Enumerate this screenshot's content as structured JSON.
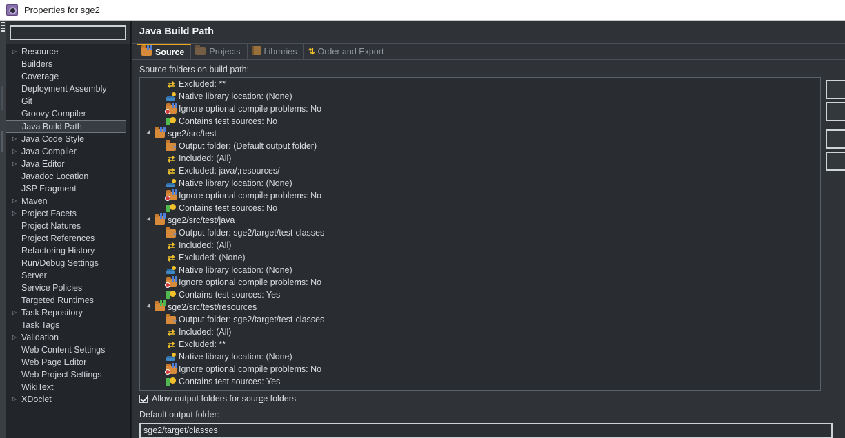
{
  "window": {
    "title": "Properties for sge2",
    "icon": "properties-gear-icon"
  },
  "sidebar": {
    "filter": {
      "value": "",
      "placeholder": ""
    },
    "items": [
      {
        "label": "Resource",
        "expandable": true,
        "selected": false
      },
      {
        "label": "Builders",
        "expandable": false,
        "selected": false
      },
      {
        "label": "Coverage",
        "expandable": false,
        "selected": false
      },
      {
        "label": "Deployment Assembly",
        "expandable": false,
        "selected": false
      },
      {
        "label": "Git",
        "expandable": false,
        "selected": false
      },
      {
        "label": "Groovy Compiler",
        "expandable": false,
        "selected": false
      },
      {
        "label": "Java Build Path",
        "expandable": false,
        "selected": true
      },
      {
        "label": "Java Code Style",
        "expandable": true,
        "selected": false
      },
      {
        "label": "Java Compiler",
        "expandable": true,
        "selected": false
      },
      {
        "label": "Java Editor",
        "expandable": true,
        "selected": false
      },
      {
        "label": "Javadoc Location",
        "expandable": false,
        "selected": false
      },
      {
        "label": "JSP Fragment",
        "expandable": false,
        "selected": false
      },
      {
        "label": "Maven",
        "expandable": true,
        "selected": false
      },
      {
        "label": "Project Facets",
        "expandable": true,
        "selected": false
      },
      {
        "label": "Project Natures",
        "expandable": false,
        "selected": false
      },
      {
        "label": "Project References",
        "expandable": false,
        "selected": false
      },
      {
        "label": "Refactoring History",
        "expandable": false,
        "selected": false
      },
      {
        "label": "Run/Debug Settings",
        "expandable": false,
        "selected": false
      },
      {
        "label": "Server",
        "expandable": false,
        "selected": false
      },
      {
        "label": "Service Policies",
        "expandable": false,
        "selected": false
      },
      {
        "label": "Targeted Runtimes",
        "expandable": false,
        "selected": false
      },
      {
        "label": "Task Repository",
        "expandable": true,
        "selected": false
      },
      {
        "label": "Task Tags",
        "expandable": false,
        "selected": false
      },
      {
        "label": "Validation",
        "expandable": true,
        "selected": false
      },
      {
        "label": "Web Content Settings",
        "expandable": false,
        "selected": false
      },
      {
        "label": "Web Page Editor",
        "expandable": false,
        "selected": false
      },
      {
        "label": "Web Project Settings",
        "expandable": false,
        "selected": false
      },
      {
        "label": "WikiText",
        "expandable": false,
        "selected": false
      },
      {
        "label": "XDoclet",
        "expandable": true,
        "selected": false
      }
    ]
  },
  "main": {
    "title": "Java Build Path",
    "tabs": [
      {
        "label": "Source",
        "icon": "source-folder-icon",
        "active": true
      },
      {
        "label": "Projects",
        "icon": "folder-icon",
        "active": false
      },
      {
        "label": "Libraries",
        "icon": "book-icon",
        "active": false
      },
      {
        "label": "Order and Export",
        "icon": "updown-arrows-icon",
        "active": false
      }
    ],
    "source_label": "Source folders on build path:",
    "tree": [
      {
        "kind": "attr",
        "icon": "excluded-icon",
        "text": "Excluded: **"
      },
      {
        "kind": "attr",
        "icon": "native-library-icon",
        "text": "Native library location: (None)"
      },
      {
        "kind": "attr",
        "icon": "ignore-problems-icon",
        "text": "Ignore optional compile problems: No"
      },
      {
        "kind": "attr",
        "icon": "test-sources-icon",
        "text": "Contains test sources: No"
      },
      {
        "kind": "root",
        "icon": "source-folder-icon",
        "text": "sge2/src/test",
        "expanded": true
      },
      {
        "kind": "attr",
        "icon": "output-folder-icon",
        "text": "Output folder: (Default output folder)"
      },
      {
        "kind": "attr",
        "icon": "included-icon",
        "text": "Included: (All)"
      },
      {
        "kind": "attr",
        "icon": "excluded-icon",
        "text": "Excluded: java/;resources/"
      },
      {
        "kind": "attr",
        "icon": "native-library-icon",
        "text": "Native library location: (None)"
      },
      {
        "kind": "attr",
        "icon": "ignore-problems-icon",
        "text": "Ignore optional compile problems: No"
      },
      {
        "kind": "attr",
        "icon": "test-sources-icon",
        "text": "Contains test sources: No"
      },
      {
        "kind": "root",
        "icon": "source-folder-icon",
        "text": "sge2/src/test/java",
        "expanded": true
      },
      {
        "kind": "attr",
        "icon": "output-folder-icon",
        "text": "Output folder: sge2/target/test-classes"
      },
      {
        "kind": "attr",
        "icon": "included-icon",
        "text": "Included: (All)"
      },
      {
        "kind": "attr",
        "icon": "excluded-icon",
        "text": "Excluded: (None)"
      },
      {
        "kind": "attr",
        "icon": "native-library-icon",
        "text": "Native library location: (None)"
      },
      {
        "kind": "attr",
        "icon": "ignore-problems-icon",
        "text": "Ignore optional compile problems: No"
      },
      {
        "kind": "attr",
        "icon": "test-sources-icon",
        "text": "Contains test sources: Yes"
      },
      {
        "kind": "root",
        "icon": "source-folder-green-icon",
        "text": "sge2/src/test/resources",
        "expanded": true
      },
      {
        "kind": "attr",
        "icon": "output-folder-icon",
        "text": "Output folder: sge2/target/test-classes"
      },
      {
        "kind": "attr",
        "icon": "included-icon",
        "text": "Included: (All)"
      },
      {
        "kind": "attr",
        "icon": "excluded-icon",
        "text": "Excluded: **"
      },
      {
        "kind": "attr",
        "icon": "native-library-icon",
        "text": "Native library location: (None)"
      },
      {
        "kind": "attr",
        "icon": "ignore-problems-icon",
        "text": "Ignore optional compile problems: No"
      },
      {
        "kind": "attr",
        "icon": "test-sources-icon",
        "text": "Contains test sources: Yes"
      }
    ],
    "side_buttons": [
      {
        "label": "",
        "name": "add-folder-button"
      },
      {
        "label": "",
        "name": "link-source-button"
      },
      {
        "label": "",
        "name": "edit-button"
      },
      {
        "label": "",
        "name": "remove-button"
      }
    ],
    "allow_output_checkbox": {
      "checked": true,
      "label_before": "Allow output folders for sour",
      "label_mnemonic": "c",
      "label_after": "e folders"
    },
    "default_output_label": "Default output folder:",
    "default_output_value": "sge2/target/classes"
  },
  "colors": {
    "accent": "#f0a818",
    "window_bg": "#2f3338",
    "sidebar_bg": "#22262b",
    "list_bg": "#292d32",
    "titlebar_bg": "#ffffff",
    "text": "#d6d9dc"
  }
}
